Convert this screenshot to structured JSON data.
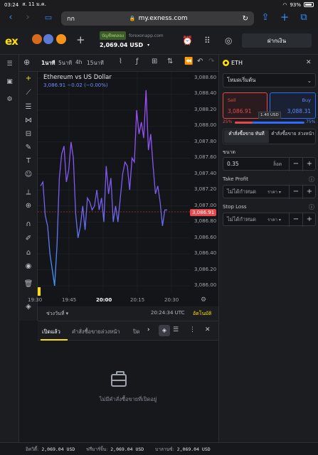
{
  "status_bar": {
    "time": "03:24",
    "date": "ส. 11 ม.ค.",
    "battery": "93%"
  },
  "browser": {
    "reader_label": "กก",
    "url": "my.exness.com"
  },
  "header": {
    "logo": "ex",
    "account_type": "บัญชีทดลอง",
    "server": "forexonapp.com",
    "balance": "2,069.04 USD",
    "deposit_label": "ฝากเงิน"
  },
  "chart_toolbar": {
    "timeframes": [
      "1นาที",
      "5นาที",
      "4h",
      "15นาที"
    ]
  },
  "chart": {
    "title": "Ethereum vs US Dollar",
    "quote": "3,086.91  −0.02 (−0.00%)",
    "current_price_tag": "3,086.91",
    "range_label": "ช่วงวันที่",
    "clock": "20:24:34 UTC",
    "auto_label": "อัตโนมัติ"
  },
  "chart_data": {
    "type": "line",
    "y_ticks": [
      "3,088.60",
      "3,088.40",
      "3,088.20",
      "3,088.00",
      "3,087.80",
      "3,087.60",
      "3,087.40",
      "3,087.20",
      "3,087.00",
      "3,086.80",
      "3,086.60",
      "3,086.40",
      "3,086.20",
      "3,086.00"
    ],
    "x_ticks": [
      "19:30",
      "19:45",
      "20:00",
      "20:15",
      "20:30"
    ],
    "ylim": [
      3085.92,
      3088.68
    ],
    "values": [
      3087.25,
      3087.3,
      3086.88,
      3086.75,
      3086.4,
      3086.2,
      3086.0,
      3086.5,
      3087.35,
      3087.65,
      3087.75,
      3087.3,
      3087.45,
      3087.8,
      3087.6,
      3086.9,
      3086.6,
      3086.75,
      3087.0,
      3086.7,
      3087.1,
      3087.05,
      3086.95,
      3087.0,
      3087.2,
      3086.95,
      3087.1,
      3086.8,
      3087.5,
      3087.15,
      3087.35,
      3086.8,
      3087.0,
      3086.8,
      3087.1,
      3087.4,
      3087.55,
      3087.5,
      3087.2,
      3087.6,
      3087.55,
      3088.2,
      3087.9,
      3088.05,
      3087.85,
      3088.45,
      3087.7,
      3087.9,
      3087.5,
      3087.15,
      3087.25,
      3087.05,
      3086.75,
      3086.95,
      3086.95
    ]
  },
  "orders": {
    "tabs": [
      "เปิดแล้ว",
      "คำสั่งซื้อขายล่วงหน้า",
      "ปิด"
    ],
    "empty_text": "ไม่มีคำสั่งซื้อขายที่เปิดอยู่"
  },
  "order_panel": {
    "symbol": "ETH",
    "mode": "โหมดเริ่มต้น",
    "sell_label": "Sell",
    "sell_price": "3,086.91",
    "buy_label": "Buy",
    "buy_price": "3,088.31",
    "spread": "1.40 USD",
    "sell_pct": "25%",
    "buy_pct": "75%",
    "tab_market": "คำสั่งซื้อขาย ทันที",
    "tab_pending": "คำสั่งซื้อขาย ล่วงหน้า",
    "volume_label": "ขนาด",
    "volume": "0.35",
    "volume_unit": "ล็อต",
    "tp_label": "Take Profit",
    "tp_value": "ไม่ได้กำหนด",
    "tp_unit": "ราคา",
    "sl_label": "Stop Loss",
    "sl_value": "ไม่ได้กำหนด",
    "sl_unit": "ราคา"
  },
  "bottom_status": {
    "equity_label": "อิควิตี้:",
    "equity": "2,069.04 USD",
    "margin_label": "ฟรีมาร์จิ้น:",
    "margin": "2,069.04 USD",
    "balance_label": "บาลานซ์:",
    "balance": "2,069.04 USD"
  },
  "colors": {
    "accent": "#ffde02",
    "sell": "#e5484d",
    "buy": "#2f6bff",
    "line": "#8e5cff"
  }
}
